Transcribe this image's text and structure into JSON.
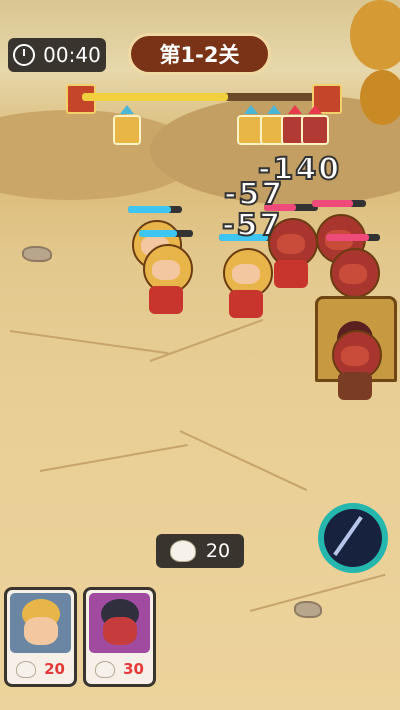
{
  "hud": {
    "timer": "00:40",
    "stage_title": "第1-2关",
    "stage_progress": 0.62,
    "resource_count": "20"
  },
  "battle": {
    "damage_numbers": [
      "-140",
      "-57",
      "-57"
    ]
  },
  "cards": [
    {
      "name": "armored-general",
      "cost": "20"
    },
    {
      "name": "dark-general",
      "cost": "30"
    }
  ],
  "colors": {
    "ally_hp": "#3ec6f2",
    "enemy_hp": "#ef4b7a",
    "stage_badge": "#7a3317",
    "cost_text": "#e53a3a"
  },
  "icons": [
    "clock-icon",
    "steamed-bun-icon",
    "spear-skill-icon"
  ]
}
